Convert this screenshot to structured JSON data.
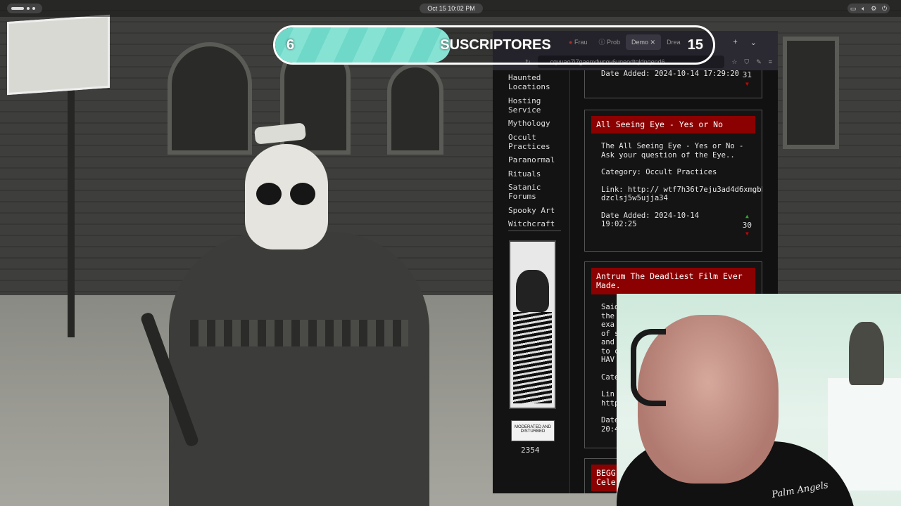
{
  "system": {
    "clock": "Oct 15  10:02 PM",
    "tray_icons": [
      "window-icon",
      "volume-icon",
      "settings-icon",
      "power-icon"
    ]
  },
  "subscriber_goal": {
    "current": "6",
    "label": "SUSCRIPTORES",
    "goal": "15",
    "progress_fraction": 0.4
  },
  "browser": {
    "tabs": [
      "Frau",
      "Prob",
      "Demo",
      "Drea"
    ],
    "active_tab_index": 2,
    "url": "cqvuao7i7gaenxfwcov6uneodtqldnqend6"
  },
  "sidebar": {
    "nav": [
      "Haunted Locations",
      "Hosting Service",
      "Mythology",
      "Occult Practices",
      "Paranormal",
      "Rituals",
      "Satanic Forums",
      "Spooky Art",
      "Witchcraft"
    ],
    "badge_text": "MODERATED AND DISTURBED",
    "visitor_count": "2354"
  },
  "listings": [
    {
      "date": "Date Added: 2024-10-14 17:29:20",
      "votes": "31"
    },
    {
      "title": "All Seeing Eye - Yes or No",
      "description": "The All Seeing Eye - Yes or No - Ask your question of the Eye..",
      "category": "Category: Occult Practices",
      "link": "Link: http:// wtf7h36t7eju3ad4d6xmgbhdzclsj5w5ujja34",
      "date": "Date Added: 2024-10-14 19:02:25",
      "votes": "30"
    },
    {
      "title": "Antrum The Deadliest Film Ever Made.",
      "description": "Said the exa of s and to c HAV",
      "category": "Cate",
      "link": "Lin http",
      "date": "Date 20:4"
    },
    {
      "title": "BEGG Cele"
    }
  ],
  "colors": {
    "accent": "#8b0000",
    "progress": "#6fd8c8"
  }
}
